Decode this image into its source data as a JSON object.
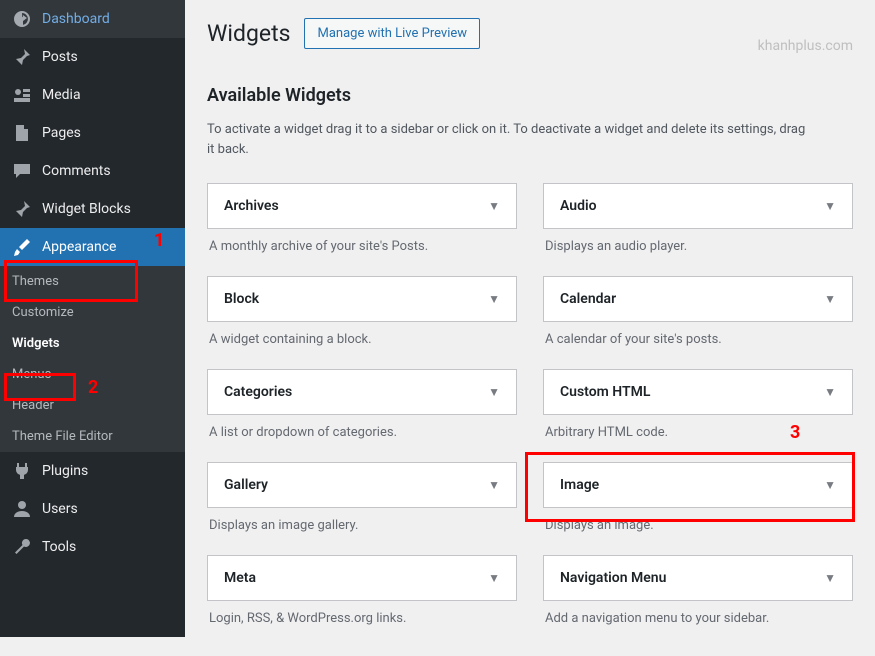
{
  "sidebar": {
    "items": [
      {
        "label": "Dashboard",
        "icon": "dashboard"
      },
      {
        "label": "Posts",
        "icon": "pin"
      },
      {
        "label": "Media",
        "icon": "media"
      },
      {
        "label": "Pages",
        "icon": "page"
      },
      {
        "label": "Comments",
        "icon": "comment"
      },
      {
        "label": "Widget Blocks",
        "icon": "pin"
      },
      {
        "label": "Appearance",
        "icon": "brush"
      },
      {
        "label": "Plugins",
        "icon": "plug"
      },
      {
        "label": "Users",
        "icon": "user"
      },
      {
        "label": "Tools",
        "icon": "wrench"
      }
    ],
    "submenu": [
      {
        "label": "Themes"
      },
      {
        "label": "Customize"
      },
      {
        "label": "Widgets"
      },
      {
        "label": "Menus"
      },
      {
        "label": "Header"
      },
      {
        "label": "Theme File Editor"
      }
    ]
  },
  "header": {
    "title": "Widgets",
    "live_preview": "Manage with Live Preview"
  },
  "section": {
    "title": "Available Widgets",
    "desc": "To activate a widget drag it to a sidebar or click on it. To deactivate a widget and delete its settings, drag it back."
  },
  "widgets_left": [
    {
      "name": "Archives",
      "desc": "A monthly archive of your site's Posts."
    },
    {
      "name": "Block",
      "desc": "A widget containing a block."
    },
    {
      "name": "Categories",
      "desc": "A list or dropdown of categories."
    },
    {
      "name": "Gallery",
      "desc": "Displays an image gallery."
    },
    {
      "name": "Meta",
      "desc": "Login, RSS, & WordPress.org links."
    }
  ],
  "widgets_right": [
    {
      "name": "Audio",
      "desc": "Displays an audio player."
    },
    {
      "name": "Calendar",
      "desc": "A calendar of your site's posts."
    },
    {
      "name": "Custom HTML",
      "desc": "Arbitrary HTML code."
    },
    {
      "name": "Image",
      "desc": "Displays an image."
    },
    {
      "name": "Navigation Menu",
      "desc": "Add a navigation menu to your sidebar."
    }
  ],
  "annotations": {
    "num1": "1",
    "num2": "2",
    "num3": "3"
  },
  "watermark": "khanhplus.com"
}
